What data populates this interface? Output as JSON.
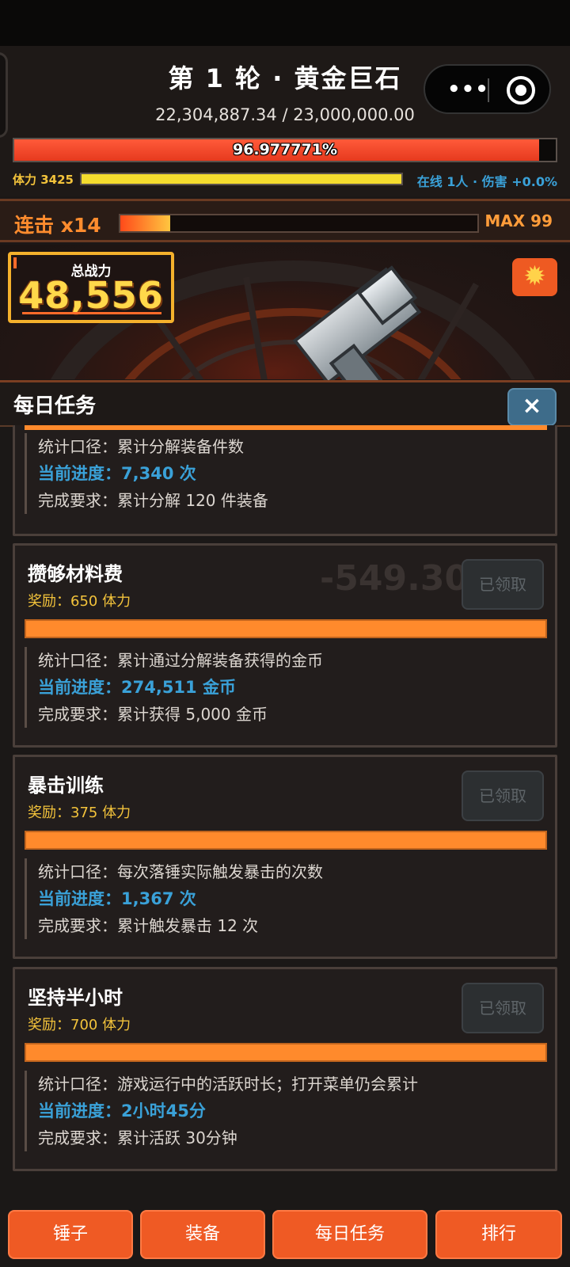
{
  "header": {
    "title": "第 1 轮 · 黄金巨石",
    "hp_text": "22,304,887.34 / 23,000,000.00",
    "hp_percent_label": "96.977771%",
    "hp_fraction": 0.96977771,
    "stamina_label": "体力 3425",
    "stamina_fraction": 1.0,
    "online_text": "在线 1人 · 伤害 +0.0%"
  },
  "capsule": {
    "more_icon": "more-dots-icon",
    "target_icon": "target-icon"
  },
  "combo": {
    "label": "连击 x14",
    "fraction": 0.14,
    "max_label": "MAX 99"
  },
  "battle": {
    "power_label": "总战力",
    "power_value": "48,556",
    "settings_icon": "gear-icon"
  },
  "panel": {
    "title": "每日任务",
    "close_label": "×",
    "tasks": [
      {
        "stat_line": "统计口径：累计分解装备件数",
        "progress_line": "当前进度：7,340 次",
        "requirement_line": "完成要求：累计分解 120 件装备"
      },
      {
        "title": "攒够材料费",
        "reward": "奖励：650 体力",
        "button": "已领取",
        "stat_line": "统计口径：累计通过分解装备获得的金币",
        "progress_line": "当前进度：274,511 金币",
        "requirement_line": "完成要求：累计获得 5,000 金币",
        "floating_number": "-549.30"
      },
      {
        "title": "暴击训练",
        "reward": "奖励：375 体力",
        "button": "已领取",
        "stat_line": "统计口径：每次落锤实际触发暴击的次数",
        "progress_line": "当前进度：1,367 次",
        "requirement_line": "完成要求：累计触发暴击 12 次"
      },
      {
        "title": "坚持半小时",
        "reward": "奖励：700 体力",
        "button": "已领取",
        "stat_line": "统计口径：游戏运行中的活跃时长；打开菜单仍会累计",
        "progress_line": "当前进度：2小时45分",
        "requirement_line": "完成要求：累计活跃 30分钟"
      }
    ]
  },
  "nav": {
    "hammer": "锤子",
    "equipment": "装备",
    "daily": "每日任务",
    "rank": "排行"
  },
  "colors": {
    "accent": "#ef5a24",
    "progress_blue": "#3aa1d8",
    "reward_gold": "#f3c33b"
  }
}
